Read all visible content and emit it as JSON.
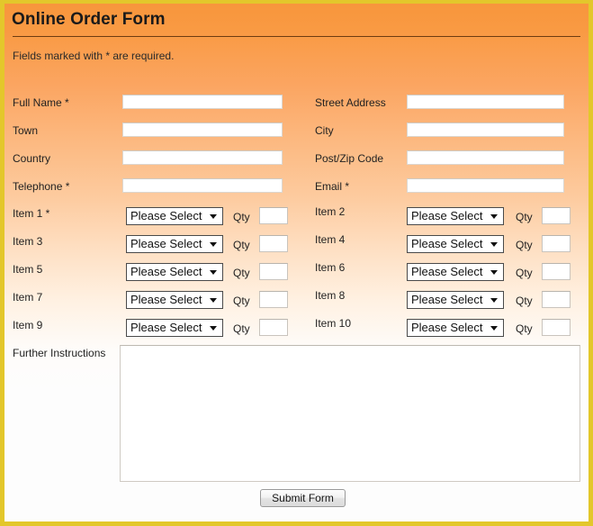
{
  "header": {
    "title": "Online Order Form",
    "required_note": "Fields marked with * are required."
  },
  "colors": {
    "frame_border": "#e3c72b",
    "gradient_top": "#f8963c",
    "gradient_bottom": "#fdfdfd",
    "title_rule": "#6e3c10",
    "field_background": "#ffffff",
    "text": "#222222"
  },
  "contact_fields": {
    "left": [
      {
        "label": "Full Name *",
        "value": "",
        "placeholder": ""
      },
      {
        "label": "Town",
        "value": "",
        "placeholder": ""
      },
      {
        "label": "Country",
        "value": "",
        "placeholder": ""
      },
      {
        "label": "Telephone *",
        "value": "",
        "placeholder": ""
      }
    ],
    "right": [
      {
        "label": "Street Address",
        "value": "",
        "placeholder": ""
      },
      {
        "label": "City",
        "value": "",
        "placeholder": ""
      },
      {
        "label": "Post/Zip Code",
        "value": "",
        "placeholder": ""
      },
      {
        "label": "Email *",
        "value": "",
        "placeholder": ""
      }
    ]
  },
  "items": {
    "qty_label": "Qty",
    "select_placeholder": "Please Select",
    "select_options": [
      "Please Select"
    ],
    "left": [
      {
        "label": "Item 1 *",
        "selected": "Please Select",
        "qty": ""
      },
      {
        "label": "Item 3",
        "selected": "Please Select",
        "qty": ""
      },
      {
        "label": "Item 5",
        "selected": "Please Select",
        "qty": ""
      },
      {
        "label": "Item 7",
        "selected": "Please Select",
        "qty": ""
      },
      {
        "label": "Item 9",
        "selected": "Please Select",
        "qty": ""
      }
    ],
    "right": [
      {
        "label": "Item 2",
        "selected": "Please Select",
        "qty": ""
      },
      {
        "label": "Item 4",
        "selected": "Please Select",
        "qty": ""
      },
      {
        "label": "Item 6",
        "selected": "Please Select",
        "qty": ""
      },
      {
        "label": "Item 8",
        "selected": "Please Select",
        "qty": ""
      },
      {
        "label": "Item 10",
        "selected": "Please Select",
        "qty": ""
      }
    ]
  },
  "notes": {
    "label": "Further Instructions",
    "value": "",
    "placeholder": ""
  },
  "watermark": {
    "text": ""
  },
  "submit": {
    "label": "Submit Form"
  }
}
